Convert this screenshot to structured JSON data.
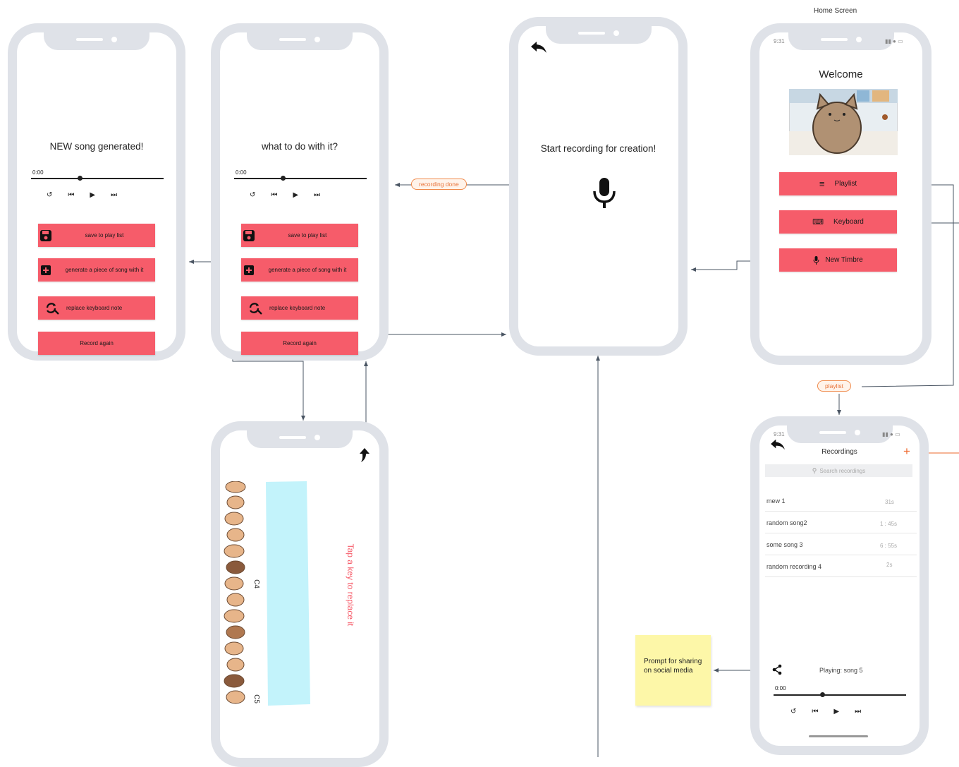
{
  "home_label": "Home Screen",
  "screen_song": {
    "title": "NEW song generated!",
    "time": "0:00",
    "buttons": [
      "save to play list",
      "generate a piece of song with it",
      "replace keyboard note",
      "Record again"
    ]
  },
  "screen_what": {
    "title": "what to do with it?",
    "time": "0:00",
    "buttons": [
      "save to play list",
      "generate a piece of song with it",
      "replace keyboard note",
      "Record again"
    ]
  },
  "screen_record": {
    "title": "Start recording  for creation!"
  },
  "screen_home": {
    "status_time": "9:31",
    "welcome": "Welcome",
    "buttons": [
      "Playlist",
      "Keyboard",
      "New Timbre"
    ]
  },
  "screen_keyboard": {
    "prompt": "Tap a key to replace it",
    "note_c4": "C4",
    "note_c5": "C5"
  },
  "screen_recordings": {
    "status_time": "9:31",
    "title": "Recordings",
    "add": "+",
    "search_placeholder": "Search recordings",
    "items": [
      {
        "name": "mew 1",
        "duration": "31s"
      },
      {
        "name": "random song2",
        "duration": "1 : 45s"
      },
      {
        "name": "some song 3",
        "duration": "6 : 55s"
      },
      {
        "name": "random recording 4",
        "duration": "2s"
      }
    ],
    "playing": "Playing: song 5",
    "time": "0:00"
  },
  "tags": {
    "recording_done": "recording done",
    "playlist": "playlist"
  },
  "sticky_note": "Prompt for sharing on social media",
  "colors": {
    "accent": "#f65c6a",
    "phone_frame": "#dfe2e8",
    "tag_orange": "#e8743a",
    "sticky": "#fdf7a8",
    "piano_key": "#c3f3fb"
  }
}
